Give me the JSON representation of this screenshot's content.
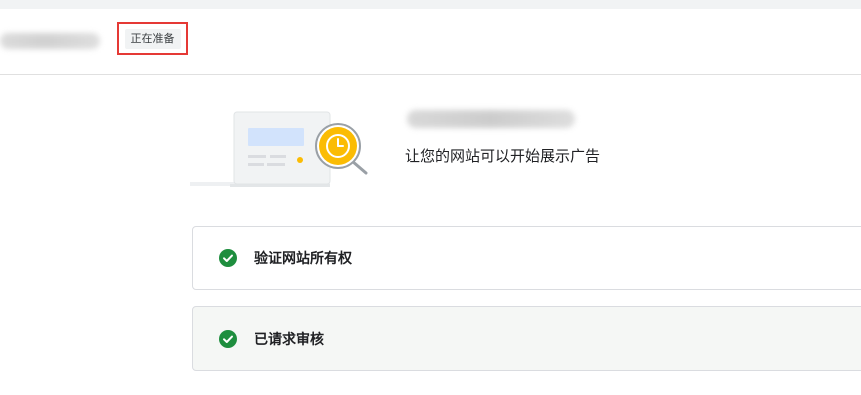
{
  "header": {
    "status_label": "正在准备"
  },
  "site": {
    "description": "让您的网站可以开始展示广告"
  },
  "steps": [
    {
      "label": "验证网站所有权",
      "status": "complete",
      "icon": "check-circle-icon"
    },
    {
      "label": "已请求审核",
      "status": "complete",
      "icon": "check-circle-icon"
    }
  ],
  "colors": {
    "success_green": "#1e8e3e",
    "badge_outline": "#e53935",
    "clock_yellow": "#fbbc04"
  }
}
